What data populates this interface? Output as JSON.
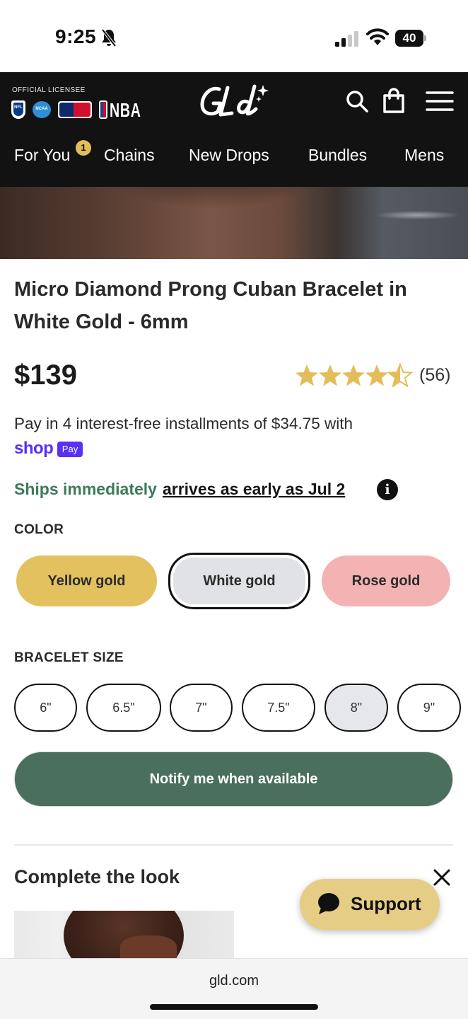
{
  "status_bar": {
    "time": "9:25",
    "battery": "40"
  },
  "header": {
    "licensee": "OFFICIAL LICENSEE",
    "leagues": [
      "NFL",
      "NCAA",
      "MLB",
      "NBA"
    ],
    "nav": [
      "For You",
      "Chains",
      "New Drops",
      "Bundles",
      "Mens"
    ],
    "for_you_badge": "1"
  },
  "product": {
    "title": "Micro Diamond Prong Cuban Bracelet in White Gold - 6mm",
    "price": "$139",
    "rating": 4.5,
    "review_count": "(56)",
    "installments": "Pay in 4 interest-free installments of $34.75 with",
    "shoppay_word": "shop",
    "shoppay_pill": "Pay",
    "ships_status": "Ships immediately",
    "ships_date": "arrives as early as Jul 2",
    "info_glyph": "i"
  },
  "color": {
    "label": "COLOR",
    "options": [
      "Yellow gold",
      "White gold",
      "Rose gold"
    ],
    "selected": "White gold"
  },
  "size": {
    "label": "BRACELET SIZE",
    "options": [
      "6\"",
      "6.5\"",
      "7\"",
      "7.5\"",
      "8\"",
      "9\""
    ],
    "selected": "8\""
  },
  "cta": {
    "notify": "Notify me when available"
  },
  "complete_look": {
    "title": "Complete the look"
  },
  "support": {
    "label": "Support"
  },
  "browser": {
    "url": "gld.com"
  },
  "colors": {
    "header_bg": "#121212",
    "badge": "#e2bd5a",
    "star": "#e2bd5a",
    "ships_green": "#3c7a5a",
    "shoppay_purple": "#5a31f4",
    "yellow_gold": "#e3c15f",
    "white_gold": "#e1e2e5",
    "rose_gold": "#f3b3b3",
    "notify_green": "#4a6f5c",
    "support_bg": "#e6cd86"
  },
  "icons": [
    "bell-slash-icon",
    "signal-icon",
    "wifi-icon",
    "battery-icon",
    "search-icon",
    "shopping-bag-icon",
    "hamburger-menu-icon",
    "star-icon",
    "info-icon",
    "close-icon",
    "chat-bubble-icon"
  ]
}
